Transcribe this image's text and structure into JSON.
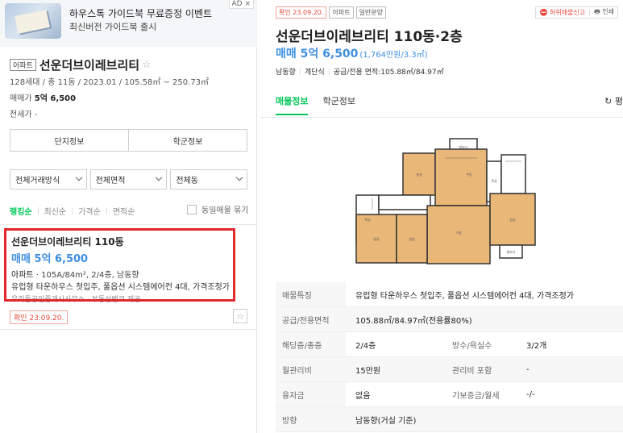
{
  "ad": {
    "title": "하우스톡 가이드북 무료증정 이벤트",
    "subtitle": "최신버전 가이드북 출시",
    "badge": "AD ×"
  },
  "complex": {
    "type_tag": "아파트",
    "name": "선운더브이레브리티",
    "info": "128세대 / 총 11동 / 2023.01 / 105.58㎡ ~ 250.73㎡",
    "sale_label": "매매가",
    "sale_value": "5억 6,500",
    "lease_label": "전세가",
    "lease_value": "-",
    "buttons": [
      "단지정보",
      "학군정보"
    ]
  },
  "filters": [
    "전체거래방식",
    "전체면적",
    "전체동"
  ],
  "sort": {
    "options": [
      "랭킹순",
      "최신순",
      "가격순",
      "면적순"
    ],
    "active": "랭킹순",
    "dup_label": "동일매물 묶기"
  },
  "listing": {
    "title": "선운더브이레브리티 110동",
    "price": "매매 5억 6,500",
    "type": "아파트",
    "spec": "105A/84m², 2/4층, 남동향",
    "desc": "유럽형 타운하우스 첫입주, 풀옵션 시스템에어컨 4대, 가격조정가",
    "sub": "우리들공인중개사사무소 · 부동산뱅크 제공",
    "confirm": "확인 23.09.20."
  },
  "detail": {
    "tags": [
      "확인 23.09.20.",
      "아파트",
      "일반분양"
    ],
    "tools": {
      "report": "허위매물신고",
      "print": "인쇄"
    },
    "title": "선운더브이레브리티 110동·2층",
    "price": "매매 5억 6,500",
    "price_unit": "(1,764만원/3.3㎡)",
    "meta": [
      "남동향",
      "계단식",
      "공급/전용 면적:105.88㎡/84.97㎡"
    ],
    "tabs": [
      "매물정보",
      "학군정보"
    ],
    "active_tab": "매물정보",
    "pyeong": "↻ 평",
    "floorplan_rooms": [
      "발코니",
      "침실",
      "주방",
      "거실",
      "침실",
      "침실",
      "침실",
      "욕실",
      "욕실",
      "발코니"
    ]
  },
  "table": {
    "rows": [
      {
        "k": "매물특징",
        "v": "유럽형 타운하우스 첫입주, 풀옵션 시스템에어컨 4대, 가격조정가"
      },
      {
        "k": "공급/전용면적",
        "v": "105.88㎡/84.97㎡(전용률80%)"
      },
      {
        "k": "해당층/총층",
        "v": "2/4층",
        "k2": "방수/욕실수",
        "v2": "3/2개"
      },
      {
        "k": "월관리비",
        "v": "15만원",
        "k2": "관리비 포함",
        "v2": "-"
      },
      {
        "k": "융자금",
        "v": "없음",
        "k2": "기보증금/월세",
        "v2": "-/-"
      },
      {
        "k": "방향",
        "v": "남동향(거실 기준)"
      }
    ]
  },
  "colors": {
    "accent_green": "#03c75a",
    "price_blue": "#3f8fe0",
    "confirm_red": "#e64b3c",
    "highlight_red": "#e0282d"
  }
}
